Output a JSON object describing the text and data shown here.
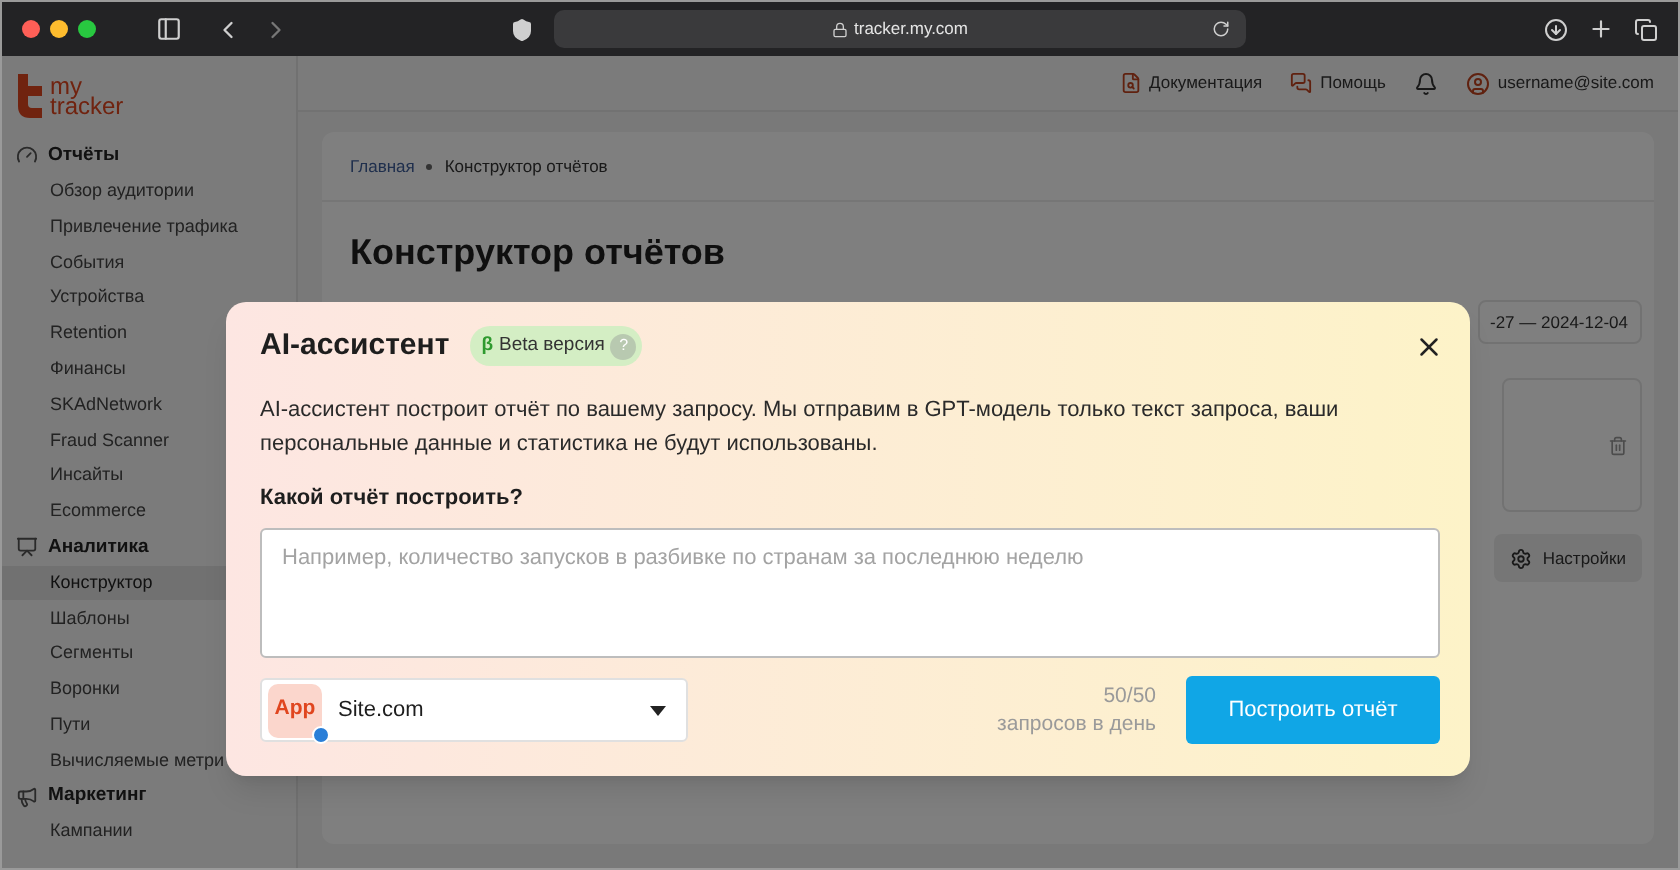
{
  "browser": {
    "url": "tracker.my.com"
  },
  "logo": {
    "line1": "my",
    "line2": "tracker"
  },
  "header": {
    "links": [
      {
        "kind": "docs",
        "label": "Документация"
      },
      {
        "kind": "help",
        "label": "Помощь"
      }
    ],
    "user": "username@site.com"
  },
  "sidebar": {
    "sections": [
      {
        "kind": "reports",
        "title": "Отчёты",
        "items": [
          {
            "label": "Обзор аудитории",
            "selected": false
          },
          {
            "label": "Привлечение трафика",
            "selected": false
          },
          {
            "label": "События",
            "selected": false
          },
          {
            "label": "Устройства",
            "selected": false
          },
          {
            "label": "Retention",
            "selected": false
          },
          {
            "label": "Финансы",
            "selected": false
          },
          {
            "label": "SKAdNetwork",
            "selected": false
          },
          {
            "label": "Fraud Scanner",
            "selected": false
          },
          {
            "label": "Инсайты",
            "selected": false
          },
          {
            "label": "Ecommerce",
            "selected": false
          }
        ]
      },
      {
        "kind": "analytics",
        "title": "Аналитика",
        "items": [
          {
            "label": "Конструктор",
            "selected": true
          },
          {
            "label": "Шаблоны",
            "selected": false
          },
          {
            "label": "Сегменты",
            "selected": false
          },
          {
            "label": "Воронки",
            "selected": false
          },
          {
            "label": "Пути",
            "selected": false
          },
          {
            "label": "Вычисляемые метри",
            "selected": false
          }
        ]
      },
      {
        "kind": "marketing",
        "title": "Маркетинг",
        "items": [
          {
            "label": "Кампании",
            "selected": false
          }
        ]
      }
    ]
  },
  "page": {
    "breadcrumb": [
      "Главная",
      "Конструктор отчётов"
    ],
    "title": "Конструктор отчётов",
    "date_range": "-27 — 2024-12-04",
    "settings_button": "Настройки"
  },
  "modal": {
    "title": "AI-ассистент",
    "badge": {
      "symbol": "β",
      "label": "Beta версия",
      "help": "?"
    },
    "description": "AI-ассистент построит отчёт по вашему запросу. Мы отправим в GPT-модель только текст запроса, ваши персональные данные и статистика не будут использованы.",
    "question": "Какой отчёт построить?",
    "query": {
      "placeholder": "Например, количество запусков в разбивке по странам за последнюю неделю"
    },
    "app_select": {
      "icon_text": "App",
      "value": "Site.com"
    },
    "quota": {
      "count": "50/50",
      "caption": "запросов в день"
    },
    "submit": "Построить отчёт"
  }
}
